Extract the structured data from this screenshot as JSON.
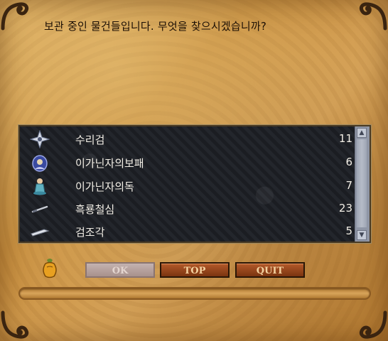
{
  "dialog": {
    "question": "보관 중인 물건들입니다. 무엇을 찾으시겠습니까?"
  },
  "items": [
    {
      "name": "수리검",
      "qty": "11",
      "icon": "shuriken-icon"
    },
    {
      "name": "이가닌자의보패",
      "qty": "6",
      "icon": "ninja-treasure-icon"
    },
    {
      "name": "이가닌자의독",
      "qty": "7",
      "icon": "poison-flask-icon"
    },
    {
      "name": "흑룡철심",
      "qty": "23",
      "icon": "iron-needle-icon"
    },
    {
      "name": "검조각",
      "qty": "5",
      "icon": "sword-fragment-icon"
    }
  ],
  "scrollbar": {
    "up": "▲",
    "down": "▼"
  },
  "buttons": {
    "ok": "OK",
    "top": "TOP",
    "quit": "QUIT"
  },
  "colors": {
    "parchment": "#c88f3f",
    "list_bg": "#1b1d22",
    "button_active": "#9a4a1c",
    "button_disabled": "#b8a2a0"
  }
}
